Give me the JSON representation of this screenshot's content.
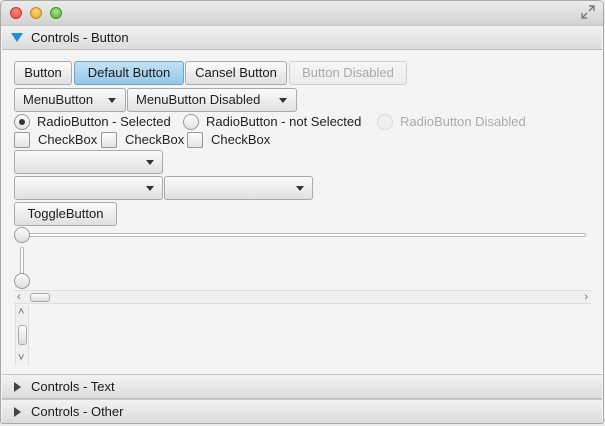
{
  "panes": [
    {
      "label": "Controls - Button",
      "expanded": true
    },
    {
      "label": "Controls - Text",
      "expanded": false
    },
    {
      "label": "Controls - Other",
      "expanded": false
    }
  ],
  "buttons": {
    "button": "Button",
    "default": "Default Button",
    "cancel": "Cansel Button",
    "disabled": "Button Disabled"
  },
  "menu_buttons": {
    "menu": "MenuButton",
    "menu_disabled": "MenuButton Disabled"
  },
  "radios": {
    "selected": "RadioButton - Selected",
    "not_selected": "RadioButton - not Selected",
    "disabled": "RadioButton Disabled"
  },
  "checkboxes": [
    "CheckBox",
    "CheckBox",
    "CheckBox"
  ],
  "toggle": "ToggleButton",
  "sliders": {
    "horizontal_value": 0,
    "vertical_value": 0
  },
  "colors": {
    "accent": "#1d8fd6",
    "default_button": "#a8d3ef"
  }
}
